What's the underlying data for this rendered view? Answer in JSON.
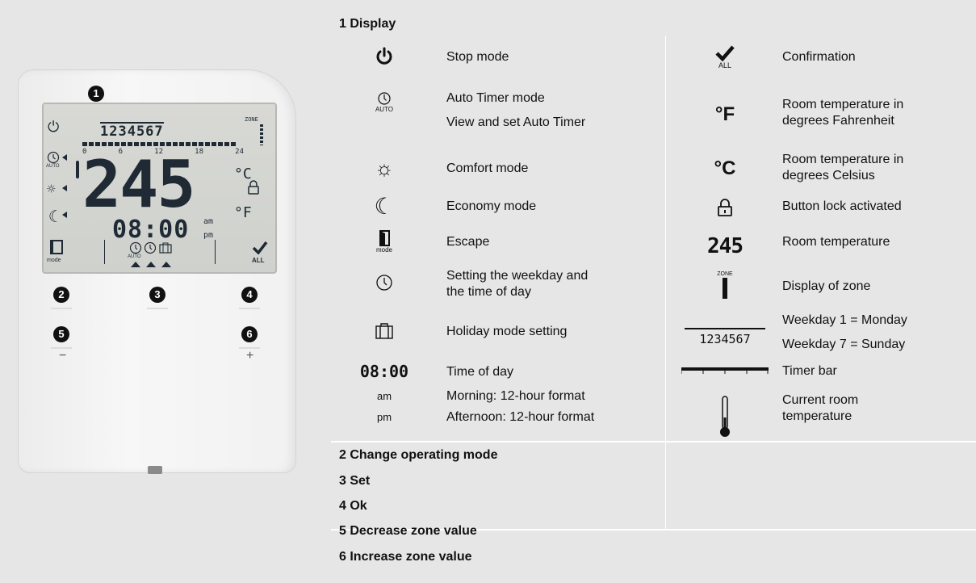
{
  "device": {
    "badges": [
      "1",
      "2",
      "3",
      "4",
      "5",
      "6"
    ],
    "minus_sign": "−",
    "plus_sign": "+",
    "lcd": {
      "weekdays": "1234567",
      "zone_label": "ZONE",
      "timer_scale": [
        "0",
        "6",
        "12",
        "18",
        "24"
      ],
      "temperature": "245",
      "unit_c": "°C",
      "unit_f": "°F",
      "time": "08:00",
      "am": "am",
      "pm": "pm",
      "auto_label": "AUTO",
      "mode_label": "mode",
      "all_label": "ALL"
    }
  },
  "sections": {
    "display": "1  Display",
    "change_mode": "2  Change operating mode",
    "set": "3  Set",
    "ok": "4  Ok",
    "decrease": "5  Decrease zone value",
    "increase": "6  Increase zone value"
  },
  "left_items": [
    {
      "icon": "power-icon",
      "lines": [
        "Stop mode"
      ]
    },
    {
      "icon": "auto-timer-icon",
      "icon_text": "AUTO",
      "lines": [
        "Auto Timer mode",
        "View and set Auto Timer"
      ]
    },
    {
      "icon": "sun-icon",
      "lines": [
        "Comfort mode"
      ]
    },
    {
      "icon": "moon-icon",
      "lines": [
        "Economy mode"
      ]
    },
    {
      "icon": "escape-icon",
      "icon_text": "mode",
      "lines": [
        "Escape"
      ]
    },
    {
      "icon": "clock-icon",
      "lines": [
        "Setting the weekday and",
        "the time of day"
      ]
    },
    {
      "icon": "holiday-icon",
      "lines": [
        "Holiday mode setting"
      ]
    },
    {
      "icon_text": "08:00",
      "lines": [
        "Time of day"
      ]
    },
    {
      "icon_text": "am",
      "lines": [
        "Morning: 12-hour format"
      ]
    },
    {
      "icon_text": "pm",
      "lines": [
        "Afternoon: 12-hour format"
      ]
    }
  ],
  "right_items": [
    {
      "icon": "check-icon",
      "icon_text": "ALL",
      "lines": [
        "Confirmation"
      ]
    },
    {
      "icon_text": "°F",
      "lines": [
        "Room temperature in",
        "degrees Fahrenheit"
      ]
    },
    {
      "icon_text": "°C",
      "lines": [
        "Room temperature in",
        "degrees Celsius"
      ]
    },
    {
      "icon": "lock-icon",
      "lines": [
        "Button lock activated"
      ]
    },
    {
      "icon_text": "245",
      "lines": [
        "Room temperature"
      ]
    },
    {
      "icon": "zone-icon",
      "icon_text": "ZONE",
      "lines": [
        "Display of zone"
      ]
    },
    {
      "icon_text": "1234567",
      "lines": [
        "Weekday 1 = Monday",
        "Weekday 7 = Sunday"
      ]
    },
    {
      "icon": "timer-bar-icon",
      "lines": [
        "Timer bar"
      ]
    },
    {
      "icon": "thermometer-icon",
      "lines": [
        "Current room",
        "temperature"
      ]
    }
  ]
}
